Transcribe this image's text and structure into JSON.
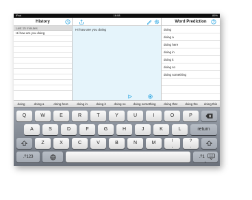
{
  "status": {
    "left": "iPad",
    "time": "16:08",
    "right": "86%"
  },
  "history": {
    "title": "History",
    "subheader": "Last 15 minutes",
    "items": [
      "Hi how are you doing"
    ]
  },
  "editor": {
    "text": "Hi how are you doing"
  },
  "prediction": {
    "title": "Word Prediction",
    "items": [
      "doing",
      "doing a",
      "doing here",
      "doing in",
      "doing it",
      "doing so",
      "doing something"
    ]
  },
  "suggestions": [
    "doing",
    "doing a",
    "doing here",
    "doing in",
    "doing it",
    "doing so",
    "doing something",
    "doing that",
    "doing the",
    "doing this"
  ],
  "keyboard": {
    "row1": [
      "Q",
      "W",
      "E",
      "R",
      "T",
      "Y",
      "U",
      "I",
      "O",
      "P"
    ],
    "row2": [
      "A",
      "S",
      "D",
      "F",
      "G",
      "H",
      "J",
      "K",
      "L"
    ],
    "return_label": "return",
    "row3": [
      "Z",
      "X",
      "C",
      "V",
      "B",
      "N",
      "M",
      "!",
      "?"
    ],
    "row3_sub": [
      ",",
      "."
    ],
    "numbers_label": ".?123",
    "icons": [
      "backspace-icon",
      "shift-icon",
      "globe-icon",
      "keyboard-dismiss-icon"
    ]
  },
  "accent": "#1a9fe0"
}
